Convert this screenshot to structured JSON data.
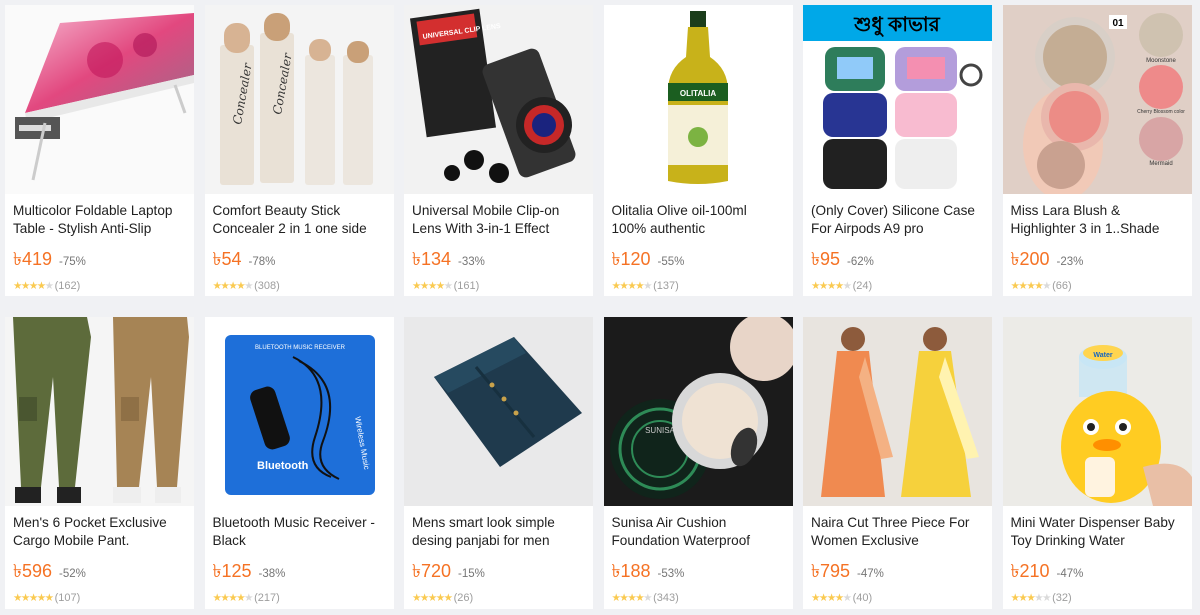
{
  "products": [
    {
      "title": "Multicolor Foldable Laptop Table - Stylish Anti-Slip",
      "price": "৳419",
      "discount": "-75%",
      "reviews": "(162)",
      "rating": 4
    },
    {
      "title": "Comfort Beauty Stick Concealer 2 in 1 one side",
      "price": "৳54",
      "discount": "-78%",
      "reviews": "(308)",
      "rating": 4
    },
    {
      "title": "Universal Mobile Clip-on Lens With 3-in-1 Effect",
      "price": "৳134",
      "discount": "-33%",
      "reviews": "(161)",
      "rating": 4
    },
    {
      "title": "Olitalia Olive oil-100ml 100% authentic",
      "price": "৳120",
      "discount": "-55%",
      "reviews": "(137)",
      "rating": 4.5
    },
    {
      "title": "(Only Cover) Silicone Case For Airpods A9 pro",
      "price": "৳95",
      "discount": "-62%",
      "reviews": "(24)",
      "rating": 4.5
    },
    {
      "title": "Miss Lara Blush & Highlighter 3 in 1..Shade",
      "price": "৳200",
      "discount": "-23%",
      "reviews": "(66)",
      "rating": 4
    },
    {
      "title": "Men's 6 Pocket Exclusive Cargo Mobile Pant.",
      "price": "৳596",
      "discount": "-52%",
      "reviews": "(107)",
      "rating": 5
    },
    {
      "title": "Bluetooth Music Receiver - Black",
      "price": "৳125",
      "discount": "-38%",
      "reviews": "(217)",
      "rating": 4.5
    },
    {
      "title": "Mens smart look simple desing panjabi for men",
      "price": "৳720",
      "discount": "-15%",
      "reviews": "(26)",
      "rating": 5
    },
    {
      "title": "Sunisa Air Cushion Foundation Waterproof",
      "price": "৳188",
      "discount": "-53%",
      "reviews": "(343)",
      "rating": 4.5
    },
    {
      "title": "Naira Cut Three Piece For Women Exclusive",
      "price": "৳795",
      "discount": "-47%",
      "reviews": "(40)",
      "rating": 4
    },
    {
      "title": "Mini Water Dispenser Baby Toy Drinking Water",
      "price": "৳210",
      "discount": "-47%",
      "reviews": "(32)",
      "rating": 3
    }
  ],
  "image_text": {
    "bengali_banner": "শুধু কাভার",
    "olive_brand": "OLITALIA",
    "bt_brand": "Bluetooth",
    "bt_side": "Wireless Music",
    "bt_header": "BLUETOOTH MUSIC RECEIVER",
    "sunisa": "SUNISA",
    "lens_box": "UNIVERSAL CLIP LENS",
    "concealer": "Concealer",
    "blush_num": "01",
    "blush_1": "Moonstone",
    "blush_2": "Cherry Blossom color",
    "blush_3": "Mermaid",
    "toy_label": "Water"
  },
  "colors": {
    "price": "#f57224",
    "star": "#faca51",
    "star_off": "#dadada",
    "background": "#f0f1f4"
  }
}
